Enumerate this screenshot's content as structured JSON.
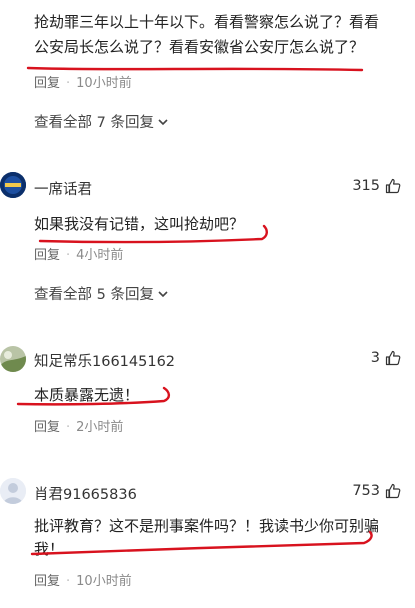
{
  "comments": [
    {
      "text_line1": "抢劫罪三年以上十年以下。看看警察怎么说了？看看",
      "text_line2": "公安局长怎么说了？看看安徽省公安厅怎么说了？",
      "reply_label": "回复",
      "time": "10小时前",
      "expand_label": "查看全部 7 条回复"
    },
    {
      "username": "一席话君",
      "likes": "315",
      "text": "如果我没有记错，这叫抢劫吧？",
      "reply_label": "回复",
      "time": "4小时前",
      "expand_label": "查看全部 5 条回复"
    },
    {
      "username": "知足常乐166145162",
      "likes": "3",
      "text": "本质暴露无遗！",
      "reply_label": "回复",
      "time": "2小时前"
    },
    {
      "username": "肖君91665836",
      "likes": "753",
      "text_line1": "批评教育？这不是刑事案件吗？！我读书少你可别骗",
      "text_line2": "我！",
      "reply_label": "回复",
      "time": "10小时前"
    }
  ],
  "colors": {
    "annotation_red": "#d8121e",
    "meta_gray": "#8a8a8a"
  },
  "icons": [
    "thumbs-up-icon",
    "chevron-down-icon"
  ]
}
